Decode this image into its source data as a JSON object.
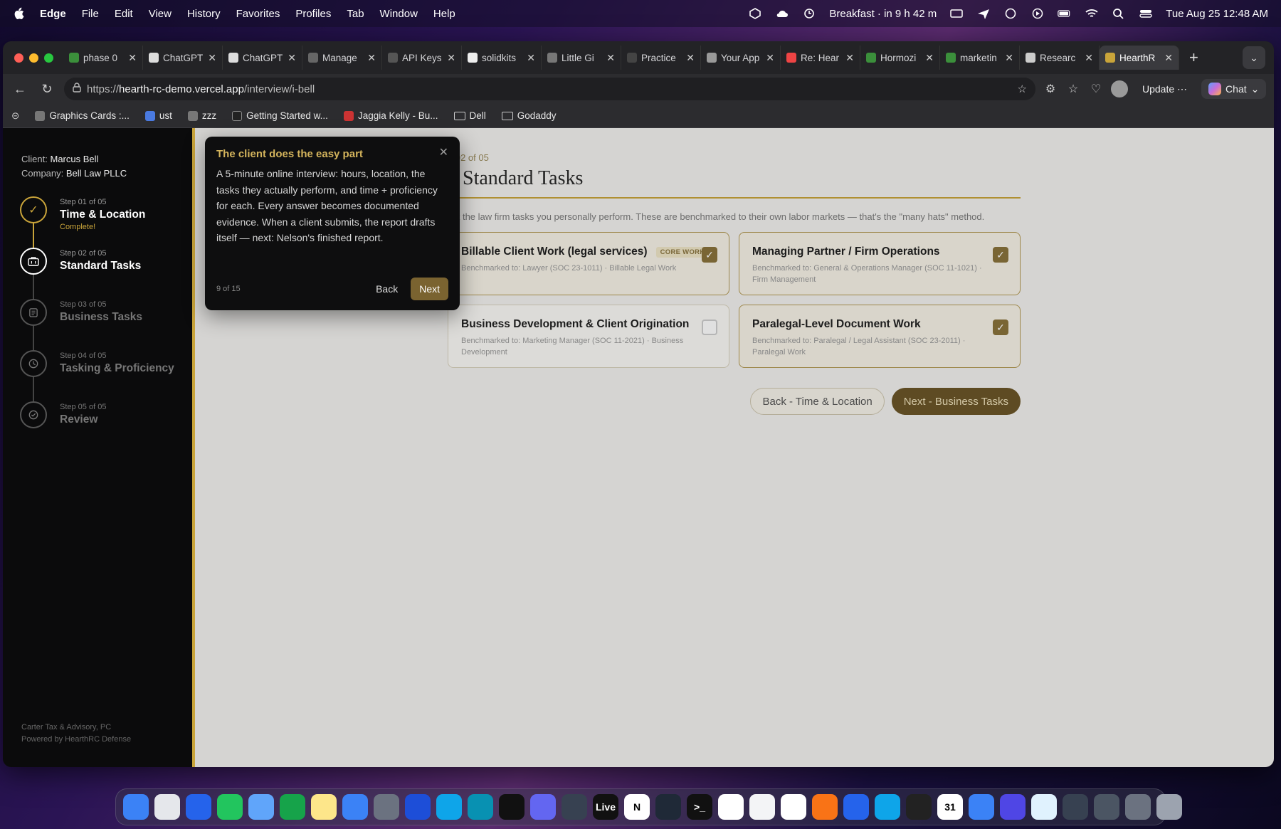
{
  "menubar": {
    "app_name": "Edge",
    "items": [
      "File",
      "Edit",
      "View",
      "History",
      "Favorites",
      "Profiles",
      "Tab",
      "Window",
      "Help"
    ],
    "calendar_event": "Breakfast · in 9 h 42 m",
    "datetime": "Tue Aug 25  12:48 AM"
  },
  "tabs": [
    {
      "title": "phase 0"
    },
    {
      "title": "ChatGPT"
    },
    {
      "title": "ChatGPT"
    },
    {
      "title": "Manage"
    },
    {
      "title": "API Keys"
    },
    {
      "title": "solidkits"
    },
    {
      "title": "Little Gi"
    },
    {
      "title": "Practice"
    },
    {
      "title": "Your App"
    },
    {
      "title": "Re: Hear"
    },
    {
      "title": "Hormozi"
    },
    {
      "title": "marketin"
    },
    {
      "title": "Researc"
    },
    {
      "title": "HearthR"
    }
  ],
  "toolbar": {
    "url_prefix": "https://",
    "url_host": "hearth-rc-demo.vercel.app",
    "url_path": "/interview/i-bell",
    "update_label": "Update",
    "chat_label": "Chat"
  },
  "bookmarks": [
    "Graphics Cards :...",
    "ust",
    "zzz",
    "Getting Started w...",
    "Jaggia Kelly - Bu...",
    "Dell",
    "Godaddy"
  ],
  "sidebar": {
    "client_label": "Client:",
    "client_name": "Marcus Bell",
    "company_label": "Company:",
    "company_name": "Bell Law PLLC",
    "steps": [
      {
        "num": "Step 01 of 05",
        "name": "Time & Location",
        "sub": "Complete!"
      },
      {
        "num": "Step 02 of 05",
        "name": "Standard Tasks",
        "sub": ""
      },
      {
        "num": "Step 03 of 05",
        "name": "Business Tasks",
        "sub": ""
      },
      {
        "num": "Step 04 of 05",
        "name": "Tasking & Proficiency",
        "sub": ""
      },
      {
        "num": "Step 05 of 05",
        "name": "Review",
        "sub": ""
      }
    ],
    "footer_line1": "Carter Tax & Advisory, PC",
    "footer_line2": "Powered by HearthRC Defense"
  },
  "main": {
    "step_kicker": "p 02 of 05",
    "title": "y Standard Tasks",
    "intro": "ect the law firm tasks you personally perform. These are benchmarked to their own labor markets — that's the \"many hats\" method.",
    "cards": [
      {
        "title": "Billable Client Work (legal services)",
        "badge": "CORE WORK",
        "bench": "Benchmarked to: Lawyer (SOC 23-1011) · Billable Legal Work",
        "checked": true
      },
      {
        "title": "Managing Partner / Firm Operations",
        "badge": "",
        "bench": "Benchmarked to: General & Operations Manager (SOC 11-1021) · Firm Management",
        "checked": true
      },
      {
        "title": "Business Development & Client Origination",
        "badge": "",
        "bench": "Benchmarked to: Marketing Manager (SOC 11-2021) · Business Development",
        "checked": false
      },
      {
        "title": "Paralegal-Level Document Work",
        "badge": "",
        "bench": "Benchmarked to: Paralegal / Legal Assistant (SOC 23-2011) · Paralegal Work",
        "checked": true
      }
    ],
    "back_label": "Back - Time & Location",
    "next_label": "Next - Business Tasks"
  },
  "tour": {
    "title": "The client does the easy part",
    "body": "A 5-minute online interview: hours, location, the tasks they actually perform, and time + proficiency for each. Every answer becomes documented evidence. When a client submits, the report drafts itself — next: Nelson's finished report.",
    "count": "9 of 15",
    "back_label": "Back",
    "next_label": "Next"
  },
  "dock": {
    "live_label": "Live",
    "calendar_day": "31"
  },
  "colors": {
    "accent_gold": "#c9a43a",
    "button_brown": "#6b5628"
  }
}
